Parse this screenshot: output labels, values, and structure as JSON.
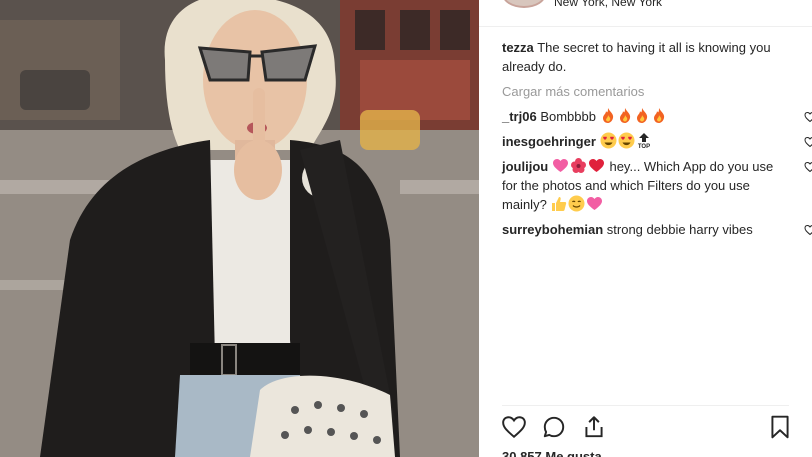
{
  "post": {
    "location": "New York, New York"
  },
  "caption": {
    "username": "tezza",
    "text": "The secret to having it all is knowing you already do."
  },
  "load_more_label": "Cargar más comentarios",
  "comments": [
    {
      "username": "_trj06",
      "text": "Bombbbb",
      "emojis": [
        "fire",
        "fire",
        "fire",
        "fire"
      ]
    },
    {
      "username": "inesgoehringer",
      "text": "",
      "emojis": [
        "heart-eyes",
        "heart-eyes",
        "top-arrow"
      ]
    },
    {
      "username": "joulijou",
      "text": "hey... Which App do you use for the photos and which Filters do you use mainly?",
      "emojis_before": [
        "pink-heart",
        "hibiscus",
        "red-heart"
      ],
      "emojis_after": [
        "thumbs-up",
        "smile",
        "pink-heart"
      ]
    },
    {
      "username": "surreybohemian",
      "text": "strong debbie harry vibes",
      "emojis": []
    }
  ],
  "likes": "30.857 Me gusta",
  "icons": {
    "like": "heart-icon",
    "comment": "comment-icon",
    "share": "share-icon",
    "save": "bookmark-icon"
  },
  "colors": {
    "text": "#262626",
    "muted": "#999999",
    "divider": "#efefef",
    "heart_red": "#ed4956"
  }
}
